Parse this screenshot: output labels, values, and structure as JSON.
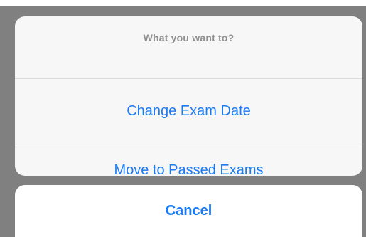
{
  "action_sheet": {
    "title": "What you want to?",
    "actions": [
      {
        "label": "Change Exam Date"
      },
      {
        "label": "Move to Passed Exams"
      }
    ],
    "cancel_label": "Cancel"
  },
  "colors": {
    "accent": "#1a7bf5",
    "title_text": "#8f8f8f",
    "overlay": "#808080",
    "sheet_background": "#f7f7f7",
    "cancel_background": "#ffffff"
  }
}
